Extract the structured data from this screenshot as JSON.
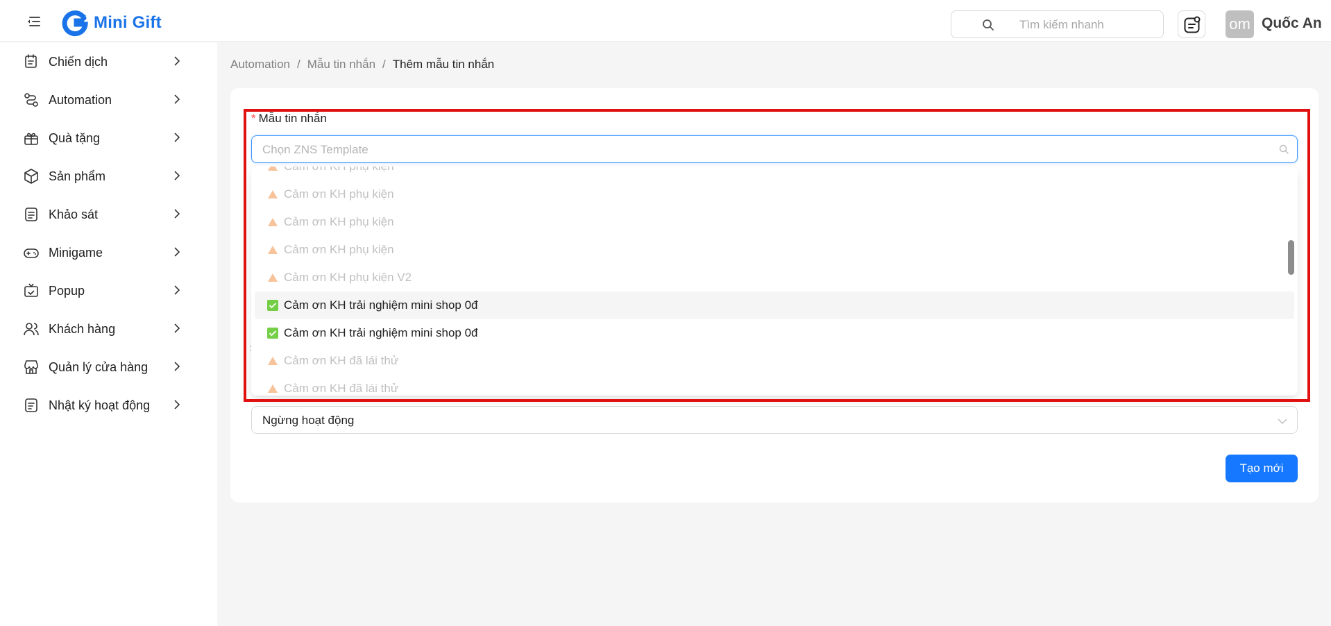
{
  "header": {
    "brand": "Mini Gift",
    "search_placeholder": "Tìm kiếm nhanh",
    "avatar_text": "om",
    "username": "Quốc An"
  },
  "sidebar": {
    "items": [
      {
        "label": "Chiến dịch",
        "icon": "campaign-icon"
      },
      {
        "label": "Automation",
        "icon": "automation-icon"
      },
      {
        "label": "Quà tặng",
        "icon": "gift-icon"
      },
      {
        "label": "Sản phẩm",
        "icon": "product-box-icon"
      },
      {
        "label": "Khảo sát",
        "icon": "survey-icon"
      },
      {
        "label": "Minigame",
        "icon": "gamepad-icon"
      },
      {
        "label": "Popup",
        "icon": "popup-icon"
      },
      {
        "label": "Khách hàng",
        "icon": "customers-icon"
      },
      {
        "label": "Quản lý cửa hàng",
        "icon": "store-icon"
      },
      {
        "label": "Nhật ký hoạt động",
        "icon": "activity-log-icon"
      }
    ]
  },
  "breadcrumb": {
    "items": [
      "Automation",
      "Mẫu tin nhắn",
      "Thêm mẫu tin nhắn"
    ]
  },
  "form": {
    "template_label": "Mẫu tin nhắn",
    "template_placeholder": "Chọn ZNS Template",
    "options": [
      {
        "text": "Cảm ơn KH phụ kiện",
        "status": "disabled"
      },
      {
        "text": "Cảm ơn KH phụ kiện",
        "status": "disabled"
      },
      {
        "text": "Cảm ơn KH phụ kiện",
        "status": "disabled"
      },
      {
        "text": "Cảm ơn KH phụ kiện",
        "status": "disabled"
      },
      {
        "text": "Cảm ơn KH phụ kiện V2",
        "status": "disabled"
      },
      {
        "text": "Cảm ơn KH trải nghiệm mini shop 0đ",
        "status": "enabled"
      },
      {
        "text": "Cảm ơn KH trải nghiệm mini shop 0đ",
        "status": "enabled"
      },
      {
        "text": "Cảm ơn KH đã lái thử",
        "status": "disabled"
      },
      {
        "text": "Cảm ơn KH đã lái thử",
        "status": "disabled"
      }
    ],
    "status_value": "Ngừng hoạt động",
    "create_label": "Tạo mới"
  },
  "colors": {
    "brand": "#1a73e8",
    "primary_button": "#1677ff",
    "highlight_border": "#e01010",
    "warning_icon": "#f6b98a",
    "check_icon": "#52c41a"
  }
}
